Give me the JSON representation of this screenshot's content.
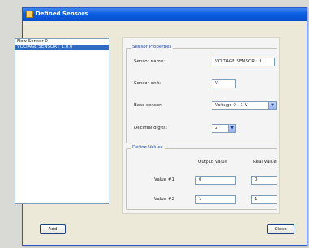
{
  "window": {
    "title": "Defined Sensors"
  },
  "sensor_list": {
    "items": [
      {
        "label": "New Sensor 0",
        "selected": false
      },
      {
        "label": "VOLTAGE SENSOR : 1.0.0",
        "selected": true
      }
    ]
  },
  "sensor_properties": {
    "legend": "Sensor Properties",
    "sensor_name": {
      "label": "Sensor name:",
      "value": "VOLTAGE SENSOR : 1"
    },
    "sensor_unit": {
      "label": "Sensor unit:",
      "value": "V"
    },
    "base_sensor": {
      "label": "Base sensor:",
      "value": "Voltage 0 - 1 V"
    },
    "decimal_digits": {
      "label": "Decimal digits:",
      "value": "2"
    }
  },
  "define_values": {
    "legend": "Define Values",
    "output_header": "Output Value",
    "real_header": "Real Value",
    "rows": [
      {
        "label": "Value #1",
        "output": "0",
        "real": "0"
      },
      {
        "label": "Value #2",
        "output": "1",
        "real": "1"
      }
    ]
  },
  "buttons": {
    "add": "Add",
    "close": "Close"
  },
  "colors": {
    "title_bar": "#0b5ee0",
    "selection": "#316ac5",
    "legend_text": "#1f4aa8"
  }
}
